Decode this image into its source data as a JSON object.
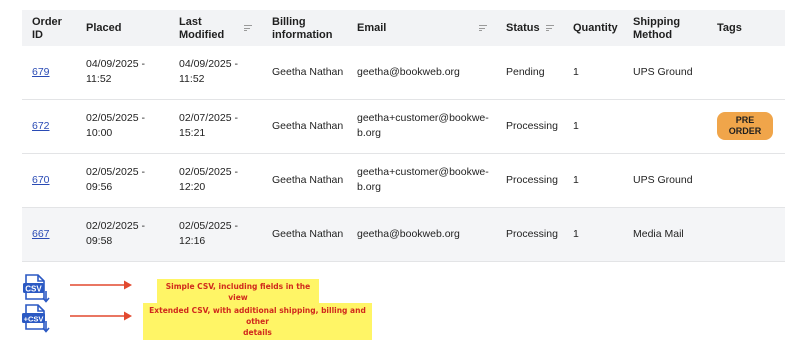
{
  "columns": {
    "order_id": "Order ID",
    "placed": "Placed",
    "last_modified": "Last Modified",
    "billing": "Billing information",
    "email": "Email",
    "status": "Status",
    "quantity": "Quantity",
    "shipping": "Shipping Method",
    "tags": "Tags"
  },
  "header_lines": {
    "order_id": [
      "Order",
      "ID"
    ],
    "last_modified": [
      "Last",
      "Modified"
    ],
    "billing": [
      "Billing",
      "information"
    ],
    "shipping": [
      "Shipping",
      "Method"
    ]
  },
  "rows": [
    {
      "order_id": "679",
      "placed": [
        "04/09/2025 -",
        "11:52"
      ],
      "modified": [
        "04/09/2025 -",
        "11:52"
      ],
      "billing": "Geetha Nathan",
      "email": [
        "geetha@bookweb.org"
      ],
      "status": "Pending",
      "quantity": "1",
      "shipping": "UPS Ground",
      "tag": [
        "",
        ""
      ]
    },
    {
      "order_id": "672",
      "placed": [
        "02/05/2025 -",
        "10:00"
      ],
      "modified": [
        "02/07/2025 -",
        "15:21"
      ],
      "billing": "Geetha Nathan",
      "email": [
        "geetha+customer@bookwe-",
        "b.org"
      ],
      "status": "Processing",
      "quantity": "1",
      "shipping": "",
      "tag": [
        "PRE",
        "ORDER"
      ]
    },
    {
      "order_id": "670",
      "placed": [
        "02/05/2025 -",
        "09:56"
      ],
      "modified": [
        "02/05/2025 -",
        "12:20"
      ],
      "billing": "Geetha Nathan",
      "email": [
        "geetha+customer@bookwe-",
        "b.org"
      ],
      "status": "Processing",
      "quantity": "1",
      "shipping": "UPS Ground",
      "tag": [
        "",
        ""
      ]
    },
    {
      "order_id": "667",
      "placed": [
        "02/02/2025 -",
        "09:58"
      ],
      "modified": [
        "02/05/2025 -",
        "12:16"
      ],
      "billing": "Geetha Nathan",
      "email": [
        "geetha@bookweb.org"
      ],
      "status": "Processing",
      "quantity": "1",
      "shipping": "Media Mail",
      "tag": [
        "",
        ""
      ]
    }
  ],
  "csv_simple": {
    "icon_label": "CSV",
    "note": "Simple CSV, including fields in the view"
  },
  "csv_extended": {
    "icon_label": "+CSV",
    "note_line1": "Extended CSV, with additional shipping, billing and other",
    "note_line2": "details"
  },
  "colors": {
    "header_bg": "#f2f3f5",
    "link": "#2a4bb5",
    "tag_bg": "#f0a54a",
    "icon_blue": "#2b59c3",
    "arrow_red": "#e2492f",
    "note_bg": "#fff566",
    "note_text": "#d0291c"
  }
}
